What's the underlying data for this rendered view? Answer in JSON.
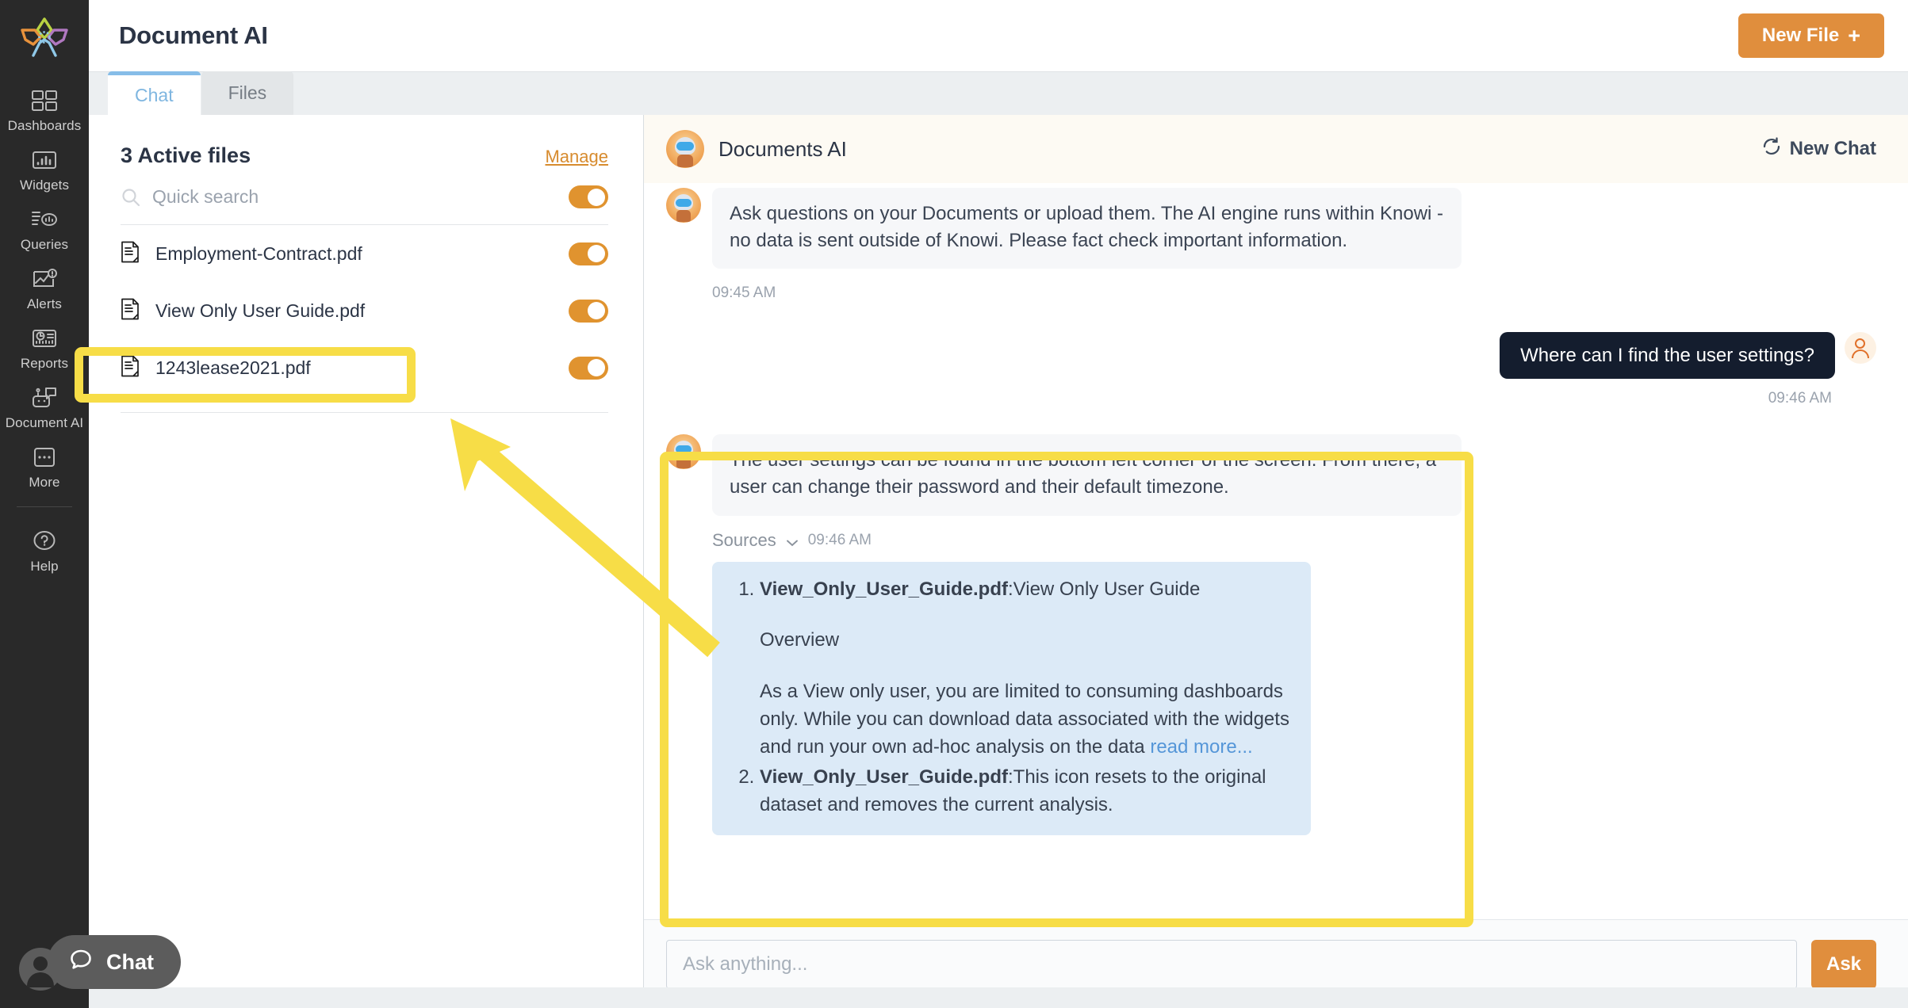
{
  "nav": {
    "logo_name": "knowi-logo",
    "items": [
      {
        "label": "Dashboards",
        "icon": "grid-icon"
      },
      {
        "label": "Widgets",
        "icon": "bar-chart-icon"
      },
      {
        "label": "Queries",
        "icon": "query-icon"
      },
      {
        "label": "Alerts",
        "icon": "alert-icon"
      },
      {
        "label": "Reports",
        "icon": "report-icon"
      },
      {
        "label": "Document AI",
        "icon": "robot-icon"
      },
      {
        "label": "More",
        "icon": "ellipsis-icon"
      }
    ],
    "help": {
      "label": "Help",
      "icon": "question-circle-icon"
    },
    "avatar_name": "user-avatar"
  },
  "topbar": {
    "title": "Document AI",
    "new_file_label": "New File",
    "new_file_plus": "+"
  },
  "tabs": [
    {
      "label": "Chat",
      "active": true
    },
    {
      "label": "Files",
      "active": false
    }
  ],
  "files_panel": {
    "title": "3 Active files",
    "manage_label": "Manage",
    "search_placeholder": "Quick search",
    "search_value": "",
    "master_toggle_on": true,
    "files": [
      {
        "name": "Employment-Contract.pdf",
        "enabled": true
      },
      {
        "name": "View Only User Guide.pdf",
        "enabled": true
      },
      {
        "name": "1243lease2021.pdf",
        "enabled": true
      }
    ]
  },
  "chat": {
    "header_title": "Documents AI",
    "new_chat_label": "New Chat",
    "intro_message": "Ask questions on your Documents or upload them. The AI engine runs within Knowi - no data is sent outside of Knowi. Please fact check important information.",
    "intro_time": "09:45 AM",
    "user_message": "Where can I find the user settings?",
    "user_time": "09:46 AM",
    "assistant_message": "The user settings can be found in the bottom left corner of the screen. From there, a user can change their password and their default timezone.",
    "sources_label": "Sources",
    "sources_time": "09:46 AM",
    "sources": [
      {
        "file": "View_Only_User_Guide.pdf",
        "snippet_head": "View Only User Guide",
        "snippet_mid": "Overview",
        "snippet_body": "As a View only user, you are limited to consuming dashboards only. While you can download data associated with the widgets and run your own ad-hoc analysis on the data",
        "read_more": "read more..."
      },
      {
        "file": "View_Only_User_Guide.pdf",
        "snippet_head": "This icon resets to the original dataset and removes the current analysis.",
        "snippet_mid": "",
        "snippet_body": "",
        "read_more": ""
      }
    ],
    "composer_placeholder": "Ask anything...",
    "composer_value": "",
    "ask_label": "Ask"
  },
  "widget": {
    "label": "Chat"
  },
  "colors": {
    "accent_orange": "#e08e3d",
    "highlight_yellow": "#f7dd47",
    "tab_blue": "#86bde8",
    "sources_blue_bg": "#dceaf7",
    "user_bubble": "#141d2e",
    "nav_bg": "#292929"
  }
}
